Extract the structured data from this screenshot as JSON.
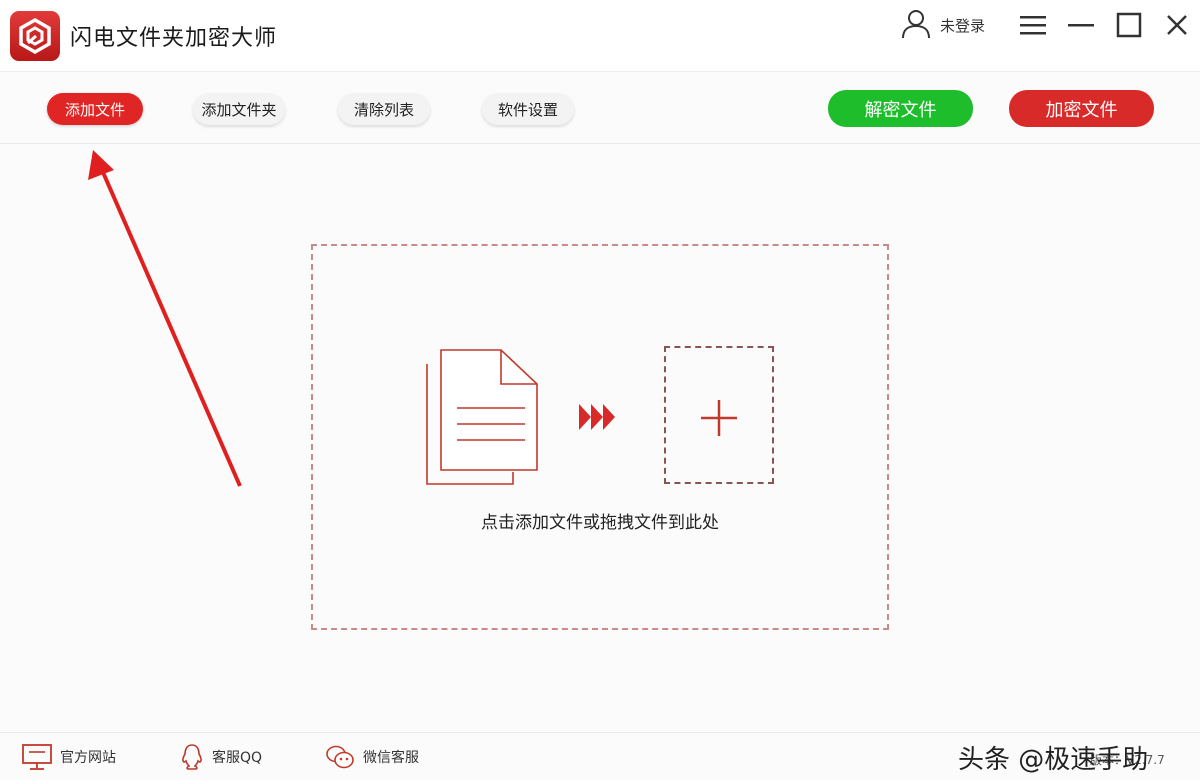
{
  "app": {
    "title": "闪电文件夹加密大师",
    "user_label": "未登录"
  },
  "toolbar": {
    "add_file": "添加文件",
    "add_folder": "添加文件夹",
    "clear_list": "清除列表",
    "settings": "软件设置",
    "decrypt": "解密文件",
    "encrypt": "加密文件"
  },
  "dropzone": {
    "hint": "点击添加文件或拖拽文件到此处"
  },
  "footer": {
    "website": "官方网站",
    "qq_support": "客服QQ",
    "wechat_support": "微信客服",
    "watermark": "头条 @极速手助",
    "version": "版本：V2.7.7"
  },
  "colors": {
    "accent_red": "#e02525",
    "decrypt_green": "#1dbd2c",
    "encrypt_red": "#d92a2a"
  },
  "icons": [
    "logo-icon",
    "user-icon",
    "menu-icon",
    "minimize-icon",
    "maximize-icon",
    "close-icon",
    "document-icon",
    "triple-arrow-icon",
    "plus-icon",
    "monitor-icon",
    "qq-icon",
    "wechat-icon"
  ]
}
